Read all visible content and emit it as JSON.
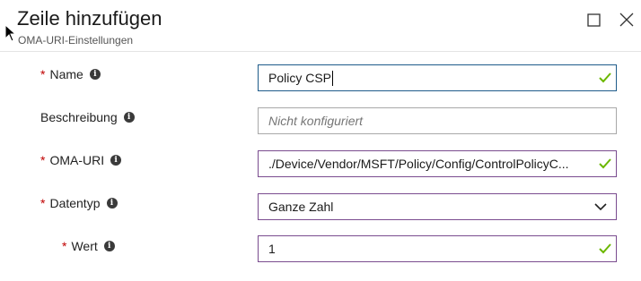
{
  "dialog": {
    "title": "Zeile hinzufügen",
    "subtitle": "OMA-URI-Einstellungen"
  },
  "icons": {
    "maximize": "maximize-icon",
    "close": "close-icon",
    "info": "info-icon",
    "valid": "checkmark-icon",
    "dropdown": "chevron-down-icon"
  },
  "colors": {
    "required": "#c00000",
    "valid_check": "#6bb700",
    "field_border": "#7a4c8f",
    "focused_border": "#1e5b8a"
  },
  "form": {
    "required_marker": "*",
    "info_glyph": "i",
    "name": {
      "label": "Name",
      "value": "Policy CSP"
    },
    "description": {
      "label": "Beschreibung",
      "placeholder": "Nicht konfiguriert"
    },
    "oma_uri": {
      "label": "OMA-URI",
      "value": "./Device/Vendor/MSFT/Policy/Config/ControlPolicyC..."
    },
    "datatype": {
      "label": "Datentyp",
      "selected": "Ganze Zahl"
    },
    "value": {
      "label": "Wert",
      "value": "1"
    }
  }
}
